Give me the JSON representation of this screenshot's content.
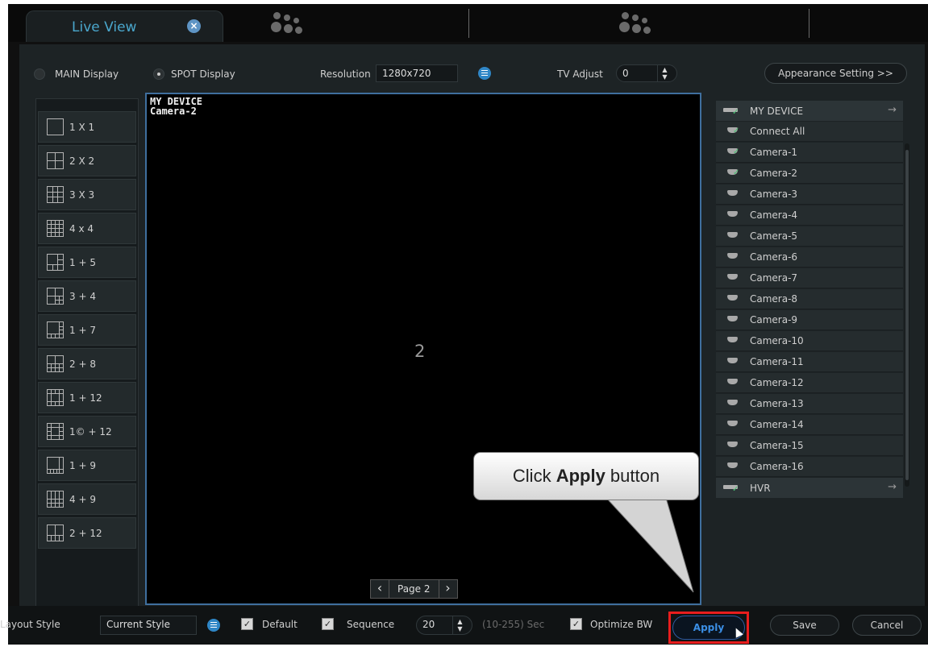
{
  "tab": {
    "title": "Live View",
    "close_icon": "close-icon"
  },
  "display": {
    "main_label": "MAIN Display",
    "spot_label": "SPOT Display",
    "resolution_label": "Resolution",
    "resolution_value": "1280x720",
    "tv_adjust_label": "TV Adjust",
    "tv_adjust_value": "0",
    "appearance_button": "Appearance Setting >>"
  },
  "layouts": [
    {
      "label": "1 X 1",
      "icon": "layout-1x1-icon"
    },
    {
      "label": "2 X 2",
      "icon": "layout-2x2-icon"
    },
    {
      "label": "3 X 3",
      "icon": "layout-3x3-icon"
    },
    {
      "label": "4 x 4",
      "icon": "layout-4x4-icon"
    },
    {
      "label": "1 + 5",
      "icon": "layout-1plus5-icon"
    },
    {
      "label": "3 + 4",
      "icon": "layout-3plus4-icon"
    },
    {
      "label": "1 + 7",
      "icon": "layout-1plus7-icon"
    },
    {
      "label": "2 + 8",
      "icon": "layout-2plus8-icon"
    },
    {
      "label": "1 + 12",
      "icon": "layout-1plus12-icon"
    },
    {
      "label": "1© + 12",
      "icon": "layout-1cplus12-icon"
    },
    {
      "label": "1 + 9",
      "icon": "layout-1plus9-icon"
    },
    {
      "label": "4 + 9",
      "icon": "layout-4plus9-icon"
    },
    {
      "label": "2 + 12",
      "icon": "layout-2plus12-icon"
    }
  ],
  "viewport": {
    "device": "MY DEVICE",
    "camera": "Camera-2",
    "channel_number": "2",
    "page_label": "Page 2"
  },
  "devices": {
    "my_device": "MY DEVICE",
    "connect_all": "Connect All",
    "cameras": [
      "Camera-1",
      "Camera-2",
      "Camera-3",
      "Camera-4",
      "Camera-5",
      "Camera-6",
      "Camera-7",
      "Camera-8",
      "Camera-9",
      "Camera-10",
      "Camera-11",
      "Camera-12",
      "Camera-13",
      "Camera-14",
      "Camera-15",
      "Camera-16"
    ],
    "hvr": "HVR"
  },
  "bottom": {
    "layout_style_label": "Layout Style",
    "layout_style_value": "Current Style",
    "default_label": "Default",
    "sequence_label": "Sequence",
    "sequence_value": "20",
    "sequence_range": "(10-255) Sec",
    "optimize_label": "Optimize BW",
    "apply": "Apply",
    "save": "Save",
    "cancel": "Cancel"
  },
  "callout": {
    "prefix": "Click ",
    "bold": "Apply",
    "suffix": " button"
  },
  "colors": {
    "accent": "#4aa7cd",
    "highlight": "#e81d1d",
    "apply_text": "#3b8fe6"
  }
}
